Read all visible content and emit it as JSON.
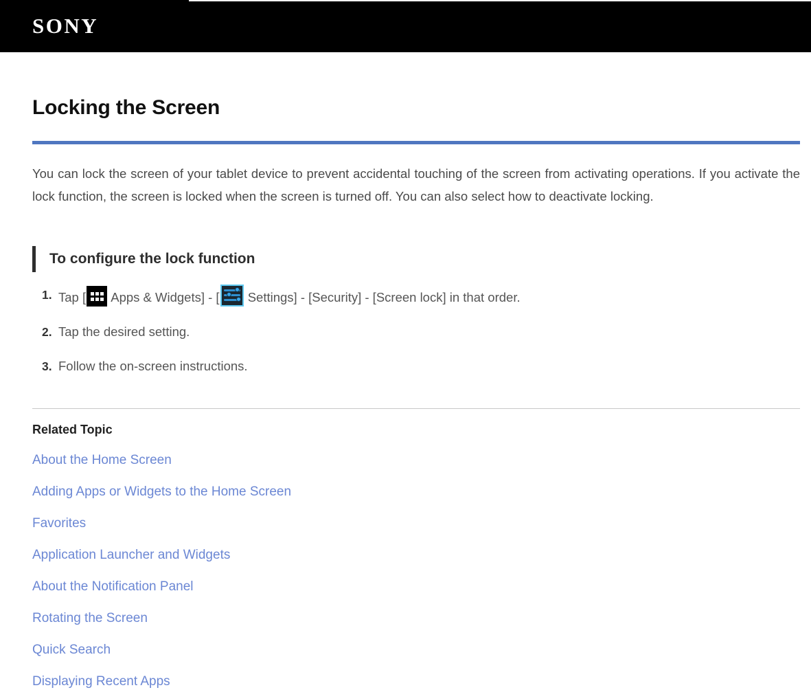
{
  "header": {
    "logo_text": "SONY"
  },
  "main": {
    "page_title": "Locking the Screen",
    "intro": "You can lock the screen of your tablet device to prevent accidental touching of the screen from activating operations. If you activate the lock function, the screen is locked when the screen is turned off. You can also select how to deactivate locking.",
    "section_title": "To configure the lock function",
    "steps": [
      {
        "number": "1.",
        "text_before_apps_icon": "Tap [",
        "apps_icon": "apps-grid-icon",
        "text_middle": " Apps & Widgets] - [",
        "settings_icon": "settings-sliders-icon",
        "text_after": " Settings] - [Security] - [Screen lock] in that order."
      },
      {
        "number": "2.",
        "text": "Tap the desired setting."
      },
      {
        "number": "3.",
        "text": "Follow the on-screen instructions."
      }
    ]
  },
  "related": {
    "title": "Related Topic",
    "links": [
      {
        "label": "About the Home Screen"
      },
      {
        "label": "Adding Apps or Widgets to the Home Screen"
      },
      {
        "label": "Favorites"
      },
      {
        "label": "Application Launcher and Widgets"
      },
      {
        "label": "About the Notification Panel"
      },
      {
        "label": "Rotating the Screen"
      },
      {
        "label": "Quick Search"
      },
      {
        "label": "Displaying Recent Apps"
      }
    ]
  },
  "colors": {
    "header_background": "#000000",
    "title_rule": "#4f76c0",
    "section_bar": "#2e2e2e",
    "link": "#6b87d4",
    "body_text": "#4a4a4a",
    "hairline": "#c8c8c8"
  }
}
